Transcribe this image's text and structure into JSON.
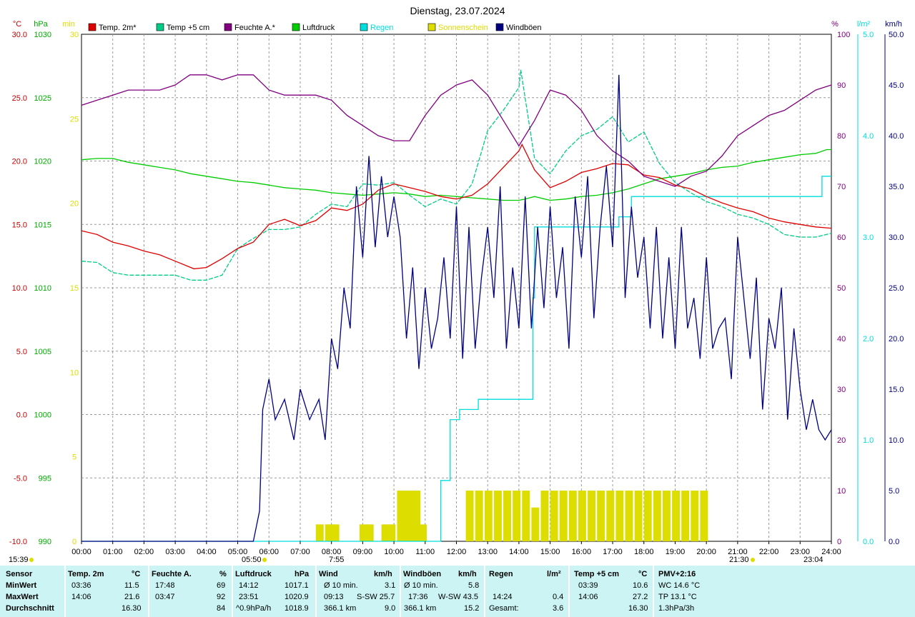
{
  "chart_data": {
    "type": "line",
    "title": "Dienstag, 23.07.2024",
    "x_ticks": [
      "00:00",
      "01:00",
      "02:00",
      "03:00",
      "04:00",
      "05:00",
      "06:00",
      "07:00",
      "08:00",
      "09:00",
      "10:00",
      "11:00",
      "12:00",
      "13:00",
      "14:00",
      "15:00",
      "16:00",
      "17:00",
      "18:00",
      "19:00",
      "20:00",
      "21:00",
      "22:00",
      "23:00",
      "24:00"
    ],
    "axes": {
      "temp": {
        "unit": "°C",
        "ticks": [
          "30.0",
          "25.0",
          "20.0",
          "15.0",
          "10.0",
          "5.0",
          "0.0",
          "-5.0",
          "-10.0"
        ],
        "range": [
          -10,
          30
        ],
        "color": "#cc0000"
      },
      "pressure": {
        "unit": "hPa",
        "ticks": [
          "1030",
          "1025",
          "1020",
          "1015",
          "1010",
          "1005",
          "1000",
          "995",
          "990"
        ],
        "range": [
          990,
          1030
        ],
        "color": "#00aa00"
      },
      "sun": {
        "unit": "min",
        "ticks": [
          "30",
          "25",
          "20",
          "15",
          "10",
          "5",
          "0"
        ],
        "range": [
          0,
          30
        ],
        "color": "#dddd00"
      },
      "humidity": {
        "unit": "%",
        "ticks": [
          "100",
          "90",
          "80",
          "70",
          "60",
          "50",
          "40",
          "30",
          "20",
          "10",
          "0"
        ],
        "range": [
          0,
          100
        ],
        "color": "#800080"
      },
      "rain": {
        "unit": "l/m²",
        "ticks": [
          "5.0",
          "4.0",
          "3.0",
          "2.0",
          "1.0",
          "0.0"
        ],
        "range": [
          0,
          5
        ],
        "color": "#00dddd"
      },
      "wind": {
        "unit": "km/h",
        "ticks": [
          "50.0",
          "45.0",
          "40.0",
          "35.0",
          "30.0",
          "25.0",
          "20.0",
          "15.0",
          "10.0",
          "5.0",
          "0.0"
        ],
        "range": [
          0,
          50
        ],
        "color": "#000080"
      }
    },
    "legend": [
      {
        "label": "Temp. 2m*",
        "color": "#dd0000"
      },
      {
        "label": "Temp +5 cm",
        "color": "#00cc88"
      },
      {
        "label": "Feuchte A.*",
        "color": "#800080"
      },
      {
        "label": "Luftdruck",
        "color": "#00cc00"
      },
      {
        "label": "Regen",
        "color": "#00dddd"
      },
      {
        "label": "Sonnenschein",
        "color": "#dddd00"
      },
      {
        "label": "Windböen",
        "color": "#000080"
      }
    ],
    "series": [
      {
        "name": "Temp. 2m*",
        "axis": "temp",
        "color": "#dd0000",
        "x": [
          0,
          0.5,
          1,
          1.5,
          2,
          2.5,
          3,
          3.6,
          4,
          4.5,
          5,
          5.5,
          6,
          6.5,
          7,
          7.5,
          8,
          8.5,
          9,
          9.5,
          10,
          10.5,
          11,
          11.5,
          12,
          12.5,
          13,
          13.5,
          14,
          14.1,
          14.5,
          15,
          15.5,
          16,
          16.5,
          17,
          17.5,
          18,
          18.5,
          19,
          19.5,
          20,
          20.5,
          21,
          21.5,
          22,
          22.5,
          23,
          23.5,
          24
        ],
        "y": [
          14.5,
          14.2,
          13.6,
          13.3,
          12.9,
          12.6,
          12.1,
          11.5,
          11.6,
          12.3,
          13.1,
          13.6,
          15.0,
          15.4,
          14.9,
          15.3,
          16.3,
          16.1,
          16.6,
          17.7,
          18.2,
          17.9,
          17.6,
          17.2,
          17.0,
          17.3,
          18.2,
          19.5,
          20.8,
          21.3,
          19.3,
          17.9,
          18.4,
          19.1,
          19.4,
          19.8,
          19.7,
          18.9,
          18.7,
          18.1,
          17.8,
          17.2,
          16.7,
          16.3,
          16.0,
          15.5,
          15.2,
          15.0,
          14.8,
          14.7
        ]
      },
      {
        "name": "Temp +5 cm",
        "axis": "temp",
        "color": "#00cc88",
        "x": [
          0,
          0.5,
          1,
          1.5,
          2,
          2.5,
          3,
          3.5,
          4,
          4.5,
          5,
          5.5,
          6,
          6.5,
          7,
          7.5,
          8,
          8.5,
          9,
          9.5,
          10,
          10.5,
          11,
          11.5,
          12,
          12.5,
          13,
          13.5,
          14,
          14.06,
          14.5,
          15,
          15.5,
          16,
          16.5,
          17,
          17.5,
          18,
          18.5,
          19,
          19.5,
          20,
          20.5,
          21,
          21.5,
          22,
          22.5,
          23,
          23.5,
          24
        ],
        "y": [
          12.1,
          12.0,
          11.2,
          11.0,
          11.0,
          11.0,
          11.0,
          10.6,
          10.6,
          11.0,
          13.1,
          13.9,
          14.6,
          14.6,
          14.8,
          15.8,
          16.6,
          16.4,
          18.2,
          18.1,
          18.3,
          17.3,
          16.4,
          17.0,
          16.6,
          18.2,
          22.4,
          24.0,
          25.8,
          27.2,
          20.2,
          19.0,
          20.8,
          22.0,
          22.5,
          23.5,
          21.5,
          22.3,
          19.8,
          18.3,
          17.5,
          16.8,
          16.4,
          15.8,
          15.5,
          15.0,
          14.2,
          14.0,
          14.0,
          14.3
        ]
      },
      {
        "name": "Feuchte A.*",
        "axis": "humidity",
        "color": "#800080",
        "x": [
          0,
          0.5,
          1,
          1.5,
          2,
          2.5,
          3,
          3.47,
          4,
          4.5,
          5,
          5.5,
          6,
          6.5,
          7,
          7.5,
          8,
          8.5,
          9,
          9.5,
          10,
          10.5,
          11,
          11.5,
          12,
          12.5,
          13,
          13.5,
          14,
          14.5,
          15,
          15.5,
          16,
          16.5,
          17,
          17.5,
          18,
          18.5,
          19,
          19.5,
          20,
          20.5,
          21,
          21.5,
          22,
          22.5,
          23,
          23.5,
          24
        ],
        "y": [
          86,
          87,
          88,
          89,
          89,
          89,
          90,
          92,
          92,
          91,
          92,
          92,
          89,
          88,
          88,
          88,
          87,
          84,
          82,
          80,
          79,
          79,
          84,
          88,
          90,
          91,
          88,
          83,
          78,
          83,
          89,
          88,
          85,
          80,
          77,
          75,
          72,
          71,
          70,
          72,
          73,
          76,
          80,
          82,
          84,
          85,
          87,
          89,
          90
        ]
      },
      {
        "name": "Luftdruck",
        "axis": "pressure",
        "color": "#00cc00",
        "x": [
          0,
          0.5,
          1,
          1.5,
          2,
          2.5,
          3,
          3.5,
          4,
          4.5,
          5,
          5.5,
          6,
          6.5,
          7,
          7.5,
          8,
          8.5,
          9,
          9.5,
          10,
          10.5,
          11,
          11.5,
          12,
          12.5,
          13,
          13.5,
          14,
          14.2,
          14.5,
          15,
          15.5,
          16,
          16.5,
          17,
          17.5,
          18,
          18.5,
          19,
          19.5,
          20,
          20.5,
          21,
          21.5,
          22,
          22.5,
          23,
          23.5,
          23.85,
          24
        ],
        "y": [
          1020.1,
          1020.2,
          1020.2,
          1019.9,
          1019.7,
          1019.5,
          1019.3,
          1019.0,
          1018.8,
          1018.6,
          1018.4,
          1018.3,
          1018.1,
          1017.9,
          1017.8,
          1017.7,
          1017.5,
          1017.4,
          1017.3,
          1017.4,
          1017.5,
          1017.4,
          1017.2,
          1017.3,
          1017.2,
          1017.1,
          1017.0,
          1016.9,
          1016.9,
          1017.0,
          1017.2,
          1016.9,
          1017.0,
          1017.2,
          1017.3,
          1017.5,
          1017.8,
          1018.2,
          1018.6,
          1018.8,
          1019.0,
          1019.3,
          1019.5,
          1019.6,
          1019.9,
          1020.1,
          1020.3,
          1020.5,
          1020.6,
          1020.9,
          1020.9
        ]
      },
      {
        "name": "Regen",
        "axis": "rain",
        "color": "#00dddd",
        "x": [
          0,
          11.2,
          11.5,
          11.8,
          12.1,
          12.4,
          12.7,
          13.0,
          13.3,
          13.6,
          14.3,
          14.45,
          14.5,
          15.5,
          16.5,
          17.2,
          17.6,
          18.0,
          18.5,
          19.5,
          20.5,
          21.5,
          22.5,
          23.6,
          23.7,
          24
        ],
        "y": [
          0,
          0,
          0.6,
          1.2,
          1.3,
          1.3,
          1.4,
          1.4,
          1.4,
          1.4,
          1.4,
          2.4,
          3.1,
          3.1,
          3.1,
          3.2,
          3.4,
          3.4,
          3.4,
          3.4,
          3.4,
          3.4,
          3.4,
          3.4,
          3.6,
          3.6
        ]
      },
      {
        "name": "Windböen",
        "axis": "wind",
        "color": "#000080",
        "x": [
          0,
          5.5,
          5.7,
          5.8,
          6.0,
          6.2,
          6.5,
          6.8,
          7.0,
          7.3,
          7.6,
          7.8,
          8.0,
          8.2,
          8.4,
          8.6,
          8.8,
          9.0,
          9.2,
          9.4,
          9.6,
          9.8,
          10.0,
          10.2,
          10.4,
          10.6,
          10.8,
          11.0,
          11.2,
          11.4,
          11.6,
          11.8,
          12.0,
          12.2,
          12.4,
          12.6,
          12.8,
          13.0,
          13.2,
          13.4,
          13.6,
          13.8,
          14.0,
          14.2,
          14.4,
          14.6,
          14.8,
          15.0,
          15.2,
          15.4,
          15.6,
          15.8,
          16.0,
          16.2,
          16.4,
          16.6,
          16.8,
          17.0,
          17.2,
          17.4,
          17.6,
          17.8,
          18.0,
          18.2,
          18.4,
          18.6,
          18.8,
          19.0,
          19.2,
          19.4,
          19.6,
          19.8,
          20.0,
          20.2,
          20.4,
          20.6,
          20.8,
          21.0,
          21.2,
          21.4,
          21.6,
          21.8,
          22.0,
          22.2,
          22.4,
          22.6,
          22.8,
          23.0,
          23.2,
          23.4,
          23.6,
          23.8,
          24.0
        ],
        "y": [
          0,
          0,
          3,
          13,
          16,
          12,
          14,
          10,
          15,
          12,
          14,
          10,
          20,
          17,
          25,
          21,
          35,
          28,
          38,
          29,
          36,
          30,
          34,
          30,
          20,
          27,
          17,
          25,
          19,
          22,
          28,
          20,
          33,
          18,
          31,
          19,
          26,
          31,
          24,
          35,
          19,
          27,
          21,
          34,
          21,
          31,
          23,
          33,
          24,
          29,
          19,
          34,
          28,
          36,
          22,
          31,
          37,
          29,
          46,
          24,
          33,
          26,
          30,
          21,
          31,
          20,
          28,
          19,
          31,
          21,
          24,
          18,
          28,
          19,
          21,
          22,
          16,
          30,
          24,
          18,
          26,
          13,
          22,
          19,
          25,
          12,
          21,
          15,
          11,
          14,
          11,
          10,
          11
        ]
      },
      {
        "name": "Sonnenschein",
        "axis": "sun",
        "color": "#dddd00",
        "x": [
          7.5,
          7.8,
          8.0,
          8.9,
          9.1,
          9.6,
          9.8,
          10.1,
          10.3,
          10.4,
          10.6,
          10.8,
          11.0,
          11.3,
          11.6,
          12.0,
          12.3,
          12.6,
          12.9,
          13.2,
          13.5,
          13.8,
          14.1,
          14.4,
          14.7,
          15.0,
          15.3,
          15.6,
          15.9,
          16.2,
          16.5,
          16.8,
          17.1,
          17.4,
          17.7,
          18.0,
          18.3,
          18.6,
          18.9,
          19.2,
          19.5,
          19.8,
          20.2,
          20.6,
          21.0,
          21.5,
          22.0,
          22.5,
          23.0
        ],
        "y": [
          1,
          1,
          1,
          1,
          1,
          1,
          1,
          3,
          3,
          3,
          3,
          1,
          0,
          0,
          0,
          0,
          3,
          3,
          3,
          3,
          3,
          3,
          3,
          2,
          3,
          3,
          3,
          3,
          3,
          3,
          3,
          3,
          3,
          3,
          3,
          3,
          3,
          3,
          3,
          3,
          3,
          3,
          0,
          0,
          0,
          0,
          0,
          0,
          0
        ]
      }
    ],
    "under_axis_labels": {
      "sunrise": "05:50",
      "sunset": "21:30",
      "left_time": "15:39",
      "mark_a": "7:55",
      "mark_b": "23:04"
    }
  },
  "bottom": {
    "sensor": {
      "title": "Sensor",
      "rows": [
        "MinWert",
        "MaxWert",
        "Durchschnitt"
      ]
    },
    "temp2m": {
      "title": "Temp. 2m",
      "unit": "°C",
      "min_time": "03:36",
      "min_val": "11.5",
      "max_time": "14:06",
      "max_val": "21.6",
      "avg": "16.30"
    },
    "humidity": {
      "title": "Feuchte A.",
      "unit": "%",
      "min_time": "17:48",
      "min_val": "69",
      "max_time": "03:47",
      "max_val": "92",
      "avg": "84"
    },
    "pressure": {
      "title": "Luftdruck",
      "unit": "hPa",
      "min_time": "14:12",
      "min_val": "1017.1",
      "max_time": "23:51",
      "max_val": "1020.9",
      "trend": "^0.9hPa/h",
      "avg": "1018.9"
    },
    "wind": {
      "title": "Wind",
      "unit": "km/h",
      "r1a": "Ø 10 min.",
      "r1b": "3.1",
      "r2a": "09:13",
      "r2b": "S-SW 25.7",
      "r3a": "366.1 km",
      "r3b": "9.0"
    },
    "gusts": {
      "title": "Windböen",
      "unit": "km/h",
      "r1a": "Ø 10 min.",
      "r1b": "5.8",
      "r2a": "17:36",
      "r2b": "W-SW 43.5",
      "r3a": "366.1 km",
      "r3b": "15.2"
    },
    "rain": {
      "title": "Regen",
      "unit": "l/m²",
      "r2a": "14:24",
      "r2b": "0.4",
      "r3a": "Gesamt:",
      "r3b": "3.6"
    },
    "temp5": {
      "title": "Temp +5 cm",
      "unit": "°C",
      "min_time": "03:39",
      "min_val": "10.6",
      "max_time": "14:06",
      "max_val": "27.2",
      "avg": "16.30"
    },
    "pmv": {
      "title": "PMV+2:16",
      "r1": "WC 14.6 °C",
      "r2": "TP 13.1 °C",
      "r3": "1.3hPa/3h"
    }
  }
}
